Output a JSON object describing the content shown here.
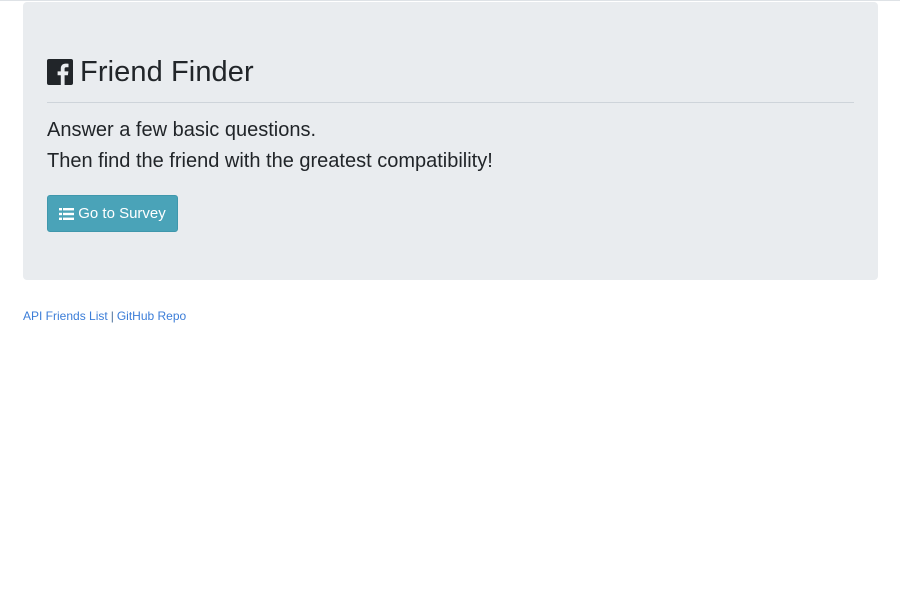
{
  "header": {
    "title": "Friend Finder",
    "brand_icon": "facebook-square-icon"
  },
  "lead": {
    "line1": "Answer a few basic questions.",
    "line2": "Then find the friend with the greatest compatibility!"
  },
  "actions": {
    "survey_button_label": "Go to Survey",
    "survey_button_icon": "list-icon"
  },
  "footer": {
    "api_link_label": "API Friends List",
    "separator": "|",
    "github_link_label": "GitHub Repo"
  },
  "colors": {
    "jumbotron_bg": "#e9ecef",
    "button_bg": "#4aa3b8",
    "link": "#3b7dd8"
  }
}
